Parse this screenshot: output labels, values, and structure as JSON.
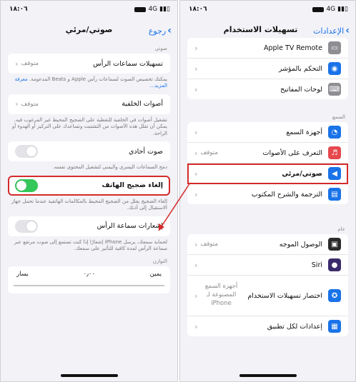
{
  "left": {
    "status": {
      "time": "١٨:٠٦",
      "network": "4G"
    },
    "nav": {
      "back_label": "رجوع",
      "title": "صوتي/مرئي"
    },
    "audio_header": "صوتي",
    "headphone_accommodations": {
      "label": "تسهيلات سماعات الرأس",
      "value": "متوقف"
    },
    "headphone_footer": "يمكنك تخصيص الصوت لسماعات رأس Apple و Beats المدعومة.",
    "learn_more": "معرفة المزيد...",
    "background_sounds": {
      "label": "أصوات الخلفية",
      "value": "متوقف"
    },
    "background_footer": "تشغيل أصوات في الخلفية للتغطية على الضجيج المحيط غير المرغوب فيه. يمكن أن تقلل هذه الأصوات من التشتيت وتساعدك على التركيز أو الهدوء أو الراحة.",
    "mono_audio": {
      "label": "صوت أحادي"
    },
    "mono_footer": "دمج السماعات اليسرى واليمنى لتشغيل المحتوى نفسه.",
    "phone_noise": {
      "label": "إلغاء ضجيج الهاتف"
    },
    "phone_noise_footer": "إلغاء الضجيج يقلل من الضجيج المحيط بالمكالمات الهاتفية عندما تحمل جهاز الاستقبال إلى أذنك.",
    "headphone_notifications": {
      "label": "إشعارات سماعة الرأس"
    },
    "notifications_footer": "لحماية سمعك، يرسل iPhone إشعارًا إذا كنت تستمع إلى صوت مرتفع عبر سماعة الرأس لمدة كافية للتأثير على سمعك.",
    "balance_header": "التوازن",
    "balance": {
      "right": "يمين",
      "center": "٠٫٠٠",
      "left": "يسار"
    }
  },
  "right": {
    "status": {
      "time": "١٨:٠٦",
      "network": "4G"
    },
    "nav": {
      "back_label": "الإعدادات",
      "title": "تسهيلات الاستخدام"
    },
    "top_items": [
      {
        "label": "Apple TV Remote",
        "icon": "tv-remote-icon",
        "color": "#8e8e93"
      },
      {
        "label": "التحكم بالمؤشر",
        "icon": "pointer-icon",
        "color": "#1a73e8"
      },
      {
        "label": "لوحات المفاتيح",
        "icon": "keyboard-icon",
        "color": "#8e8e93"
      }
    ],
    "hearing_header": "السمع",
    "hearing_items": [
      {
        "label": "أجهزة السمع",
        "value": "",
        "icon": "ear-icon",
        "color": "#1a73e8"
      },
      {
        "label": "التعرف على الأصوات",
        "value": "متوقف",
        "icon": "sound-recognition-icon",
        "color": "#e5484d"
      },
      {
        "label": "صوتي/مرئي",
        "value": "",
        "icon": "speaker-icon",
        "color": "#1a73e8"
      },
      {
        "label": "الترجمة والشرح المكتوب",
        "value": "",
        "icon": "captions-icon",
        "color": "#1a73e8"
      }
    ],
    "general_header": "عام",
    "general_items": [
      {
        "label": "الوصول الموجه",
        "value": "متوقف",
        "icon": "lock-icon",
        "color": "#2b2b2b"
      },
      {
        "label": "Siri",
        "value": "",
        "icon": "siri-icon",
        "color": "#3b2a6b"
      },
      {
        "label": "اختصار تسهيلات الاستخدام",
        "value": "أجهزة السمع المصنوعة لـ iPhone",
        "icon": "accessibility-icon",
        "color": "#1a73e8"
      },
      {
        "label": "إعدادات لكل تطبيق",
        "value": "",
        "icon": "app-settings-icon",
        "color": "#1a73e8"
      }
    ]
  },
  "colors": {
    "link": "#1a73e8",
    "toggle_on": "#34c759",
    "highlight": "#d42a2a"
  }
}
